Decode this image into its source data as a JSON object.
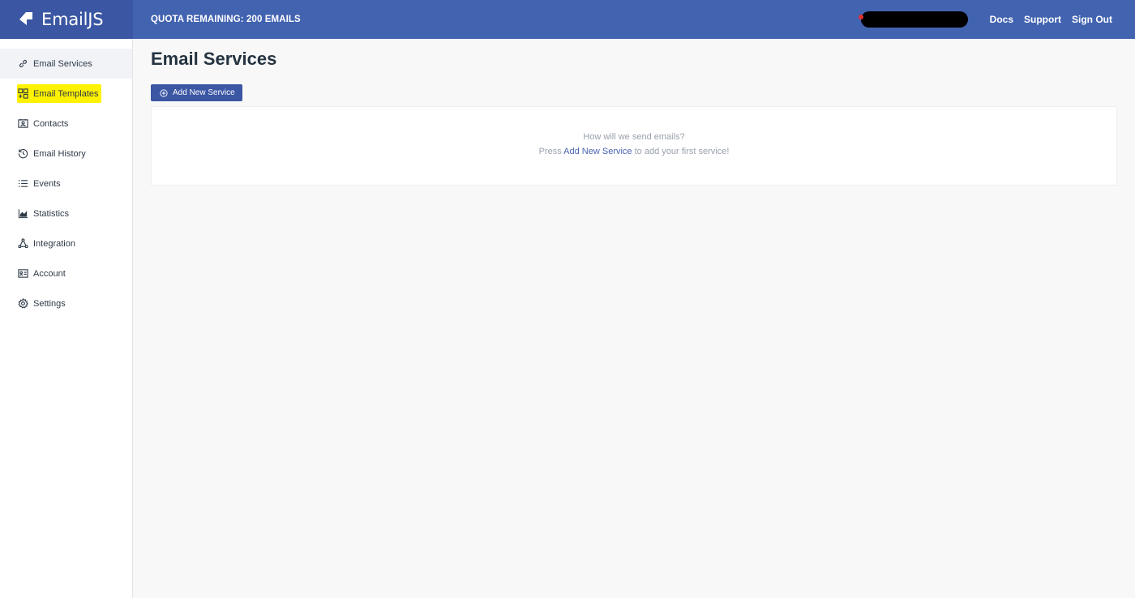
{
  "brand": {
    "name": "EmailJS"
  },
  "header": {
    "quota": "QUOTA REMAINING: 200 EMAILS",
    "links": [
      "Docs",
      "Support",
      "Sign Out"
    ]
  },
  "sidebar": {
    "items": [
      {
        "label": "Email Services",
        "icon": "link-icon",
        "active": true
      },
      {
        "label": "Email Templates",
        "icon": "templates-icon",
        "highlighted": true
      },
      {
        "label": "Contacts",
        "icon": "contacts-icon"
      },
      {
        "label": "Email History",
        "icon": "history-icon"
      },
      {
        "label": "Events",
        "icon": "list-icon"
      },
      {
        "label": "Statistics",
        "icon": "chart-icon"
      },
      {
        "label": "Integration",
        "icon": "integration-icon"
      },
      {
        "label": "Account",
        "icon": "account-icon"
      },
      {
        "label": "Settings",
        "icon": "gear-icon"
      }
    ]
  },
  "main": {
    "title": "Email Services",
    "add_button": "Add New Service",
    "empty": {
      "line1": "How will we send emails?",
      "line2_prefix": "Press",
      "line2_link": "Add New Service",
      "line2_suffix": "to add your first service!"
    }
  },
  "colors": {
    "header_bg": "#4263b0",
    "brand_bg": "#3b56a3",
    "highlight": "#fff200",
    "link": "#4a62b0"
  }
}
